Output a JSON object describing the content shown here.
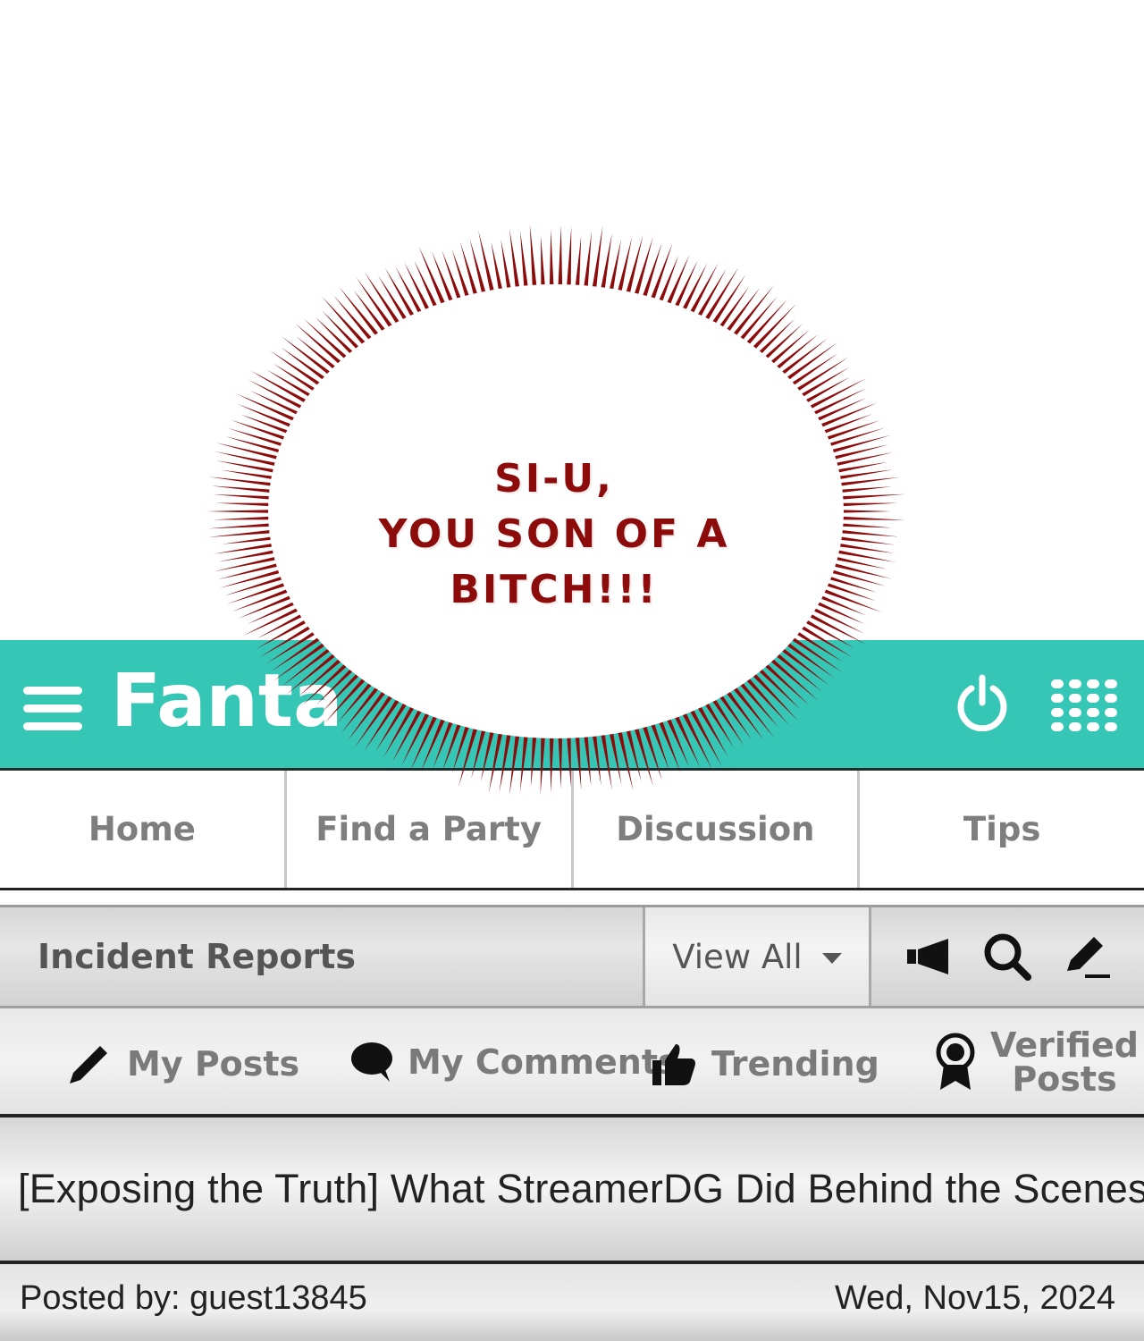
{
  "shout_bubble": {
    "lines": [
      "SI-U,",
      "YOU SON OF A",
      "BITCH!!!"
    ],
    "color": "#8c0b0b"
  },
  "app": {
    "brand": "Fanta",
    "accent_color": "#35c6b6",
    "icons": [
      "hamburger-menu-icon",
      "power-icon",
      "grid-dots-icon"
    ]
  },
  "nav": {
    "tabs": [
      "Home",
      "Find a Party",
      "Discussion",
      "Tips"
    ]
  },
  "board": {
    "title": "Incident Reports",
    "view_filter": "View All",
    "actions": [
      "megaphone-icon",
      "search-icon",
      "write-post-icon"
    ]
  },
  "filters": {
    "my_posts": "My Posts",
    "my_comments": "My Comments",
    "trending": "Trending",
    "verified_line1": "Verified",
    "verified_line2": "Posts"
  },
  "post": {
    "title": "[Exposing the Truth] What StreamerDG Did Behind the Scenes",
    "posted_by": "Posted by: guest13845",
    "date": "Wed, Nov15, 2024"
  }
}
